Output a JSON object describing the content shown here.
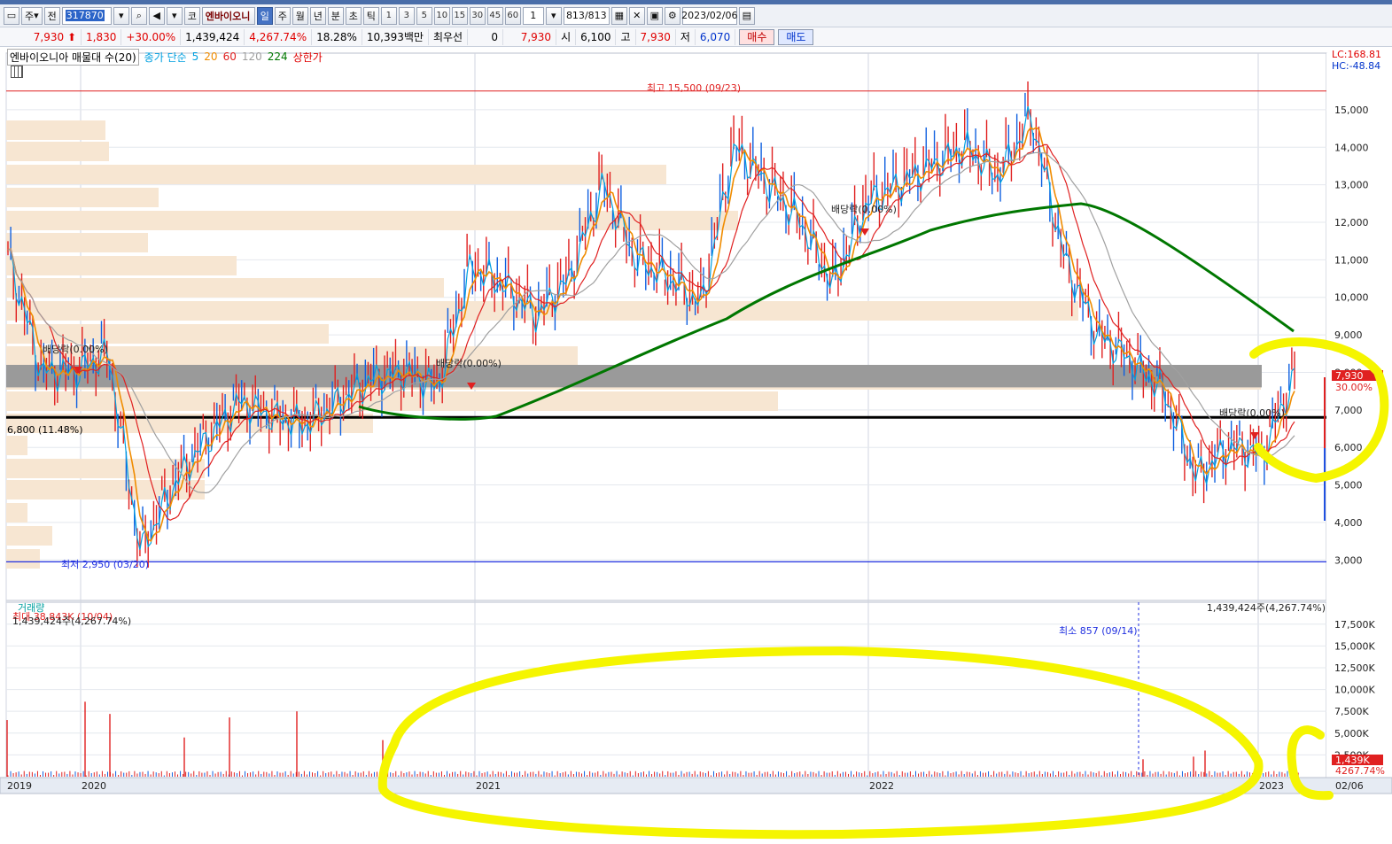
{
  "toolbar": {
    "period_labels": [
      "주",
      "전"
    ],
    "code": "317870",
    "kind": "코",
    "stock_name": "엔바이오니",
    "intervals": [
      "일",
      "주",
      "월",
      "년",
      "분",
      "초",
      "틱"
    ],
    "active_interval": "일",
    "minute_options": [
      "1",
      "3",
      "5",
      "10",
      "15",
      "30",
      "45",
      "60"
    ],
    "unit_value": "1",
    "counter_current": "813",
    "counter_total": "/813",
    "date": "2023/02/06"
  },
  "quote": {
    "price": "7,930",
    "change": "1,830",
    "change_pct": "+30.00%",
    "volume": "1,439,424",
    "volume_ratio": "4,267.74%",
    "turnover": "18.28%",
    "amount": "10,393백만",
    "pref_label": "최우선",
    "pref_value": "0",
    "pref_price": "7,930",
    "open_label": "시",
    "open": "6,100",
    "high_label": "고",
    "high": "7,930",
    "low_label": "저",
    "low": "6,070",
    "buy_label": "매수",
    "sell_label": "매도"
  },
  "legend": {
    "title": "엔바이오니아 매물대 수(20)",
    "ma_label": "종가 단순",
    "ma_periods": [
      "5",
      "20",
      "60",
      "120",
      "224"
    ],
    "ma_colors": [
      "#00a0e0",
      "#f08c00",
      "#e02020",
      "#a0a0a0",
      "#007700"
    ],
    "limit_label": "상한가",
    "lc": "LC:168.81",
    "hc": "HC:-48.84"
  },
  "annotations": {
    "high_label": "최고 15,500 (09/23)",
    "low_label": "최저 2,950 (03/20)",
    "dividend_labels": [
      "배당락(0.00%)",
      "배당락(0.00%)",
      "배당락(0.00%)",
      "배당락(0.00%)"
    ],
    "hline_label": "6,800 (11.48%)",
    "price_tag": "7,930",
    "pct_tag": "30.00%",
    "volume_panel_title": "거래량",
    "volume_current_left": "1,439,424주(4,267.74%)",
    "volume_max_left": "최대 38,843K (10/04)",
    "volume_current_right": "1,439,424주(4,267.74%)",
    "volume_min_label": "최소 857 (09/14)",
    "volume_tag": "1,439K",
    "volume_pct_tag": "4267.74%"
  },
  "chart_data": [
    {
      "type": "line",
      "title": "",
      "x": [
        "2019-09",
        "2019-11",
        "2020-01",
        "2020-02",
        "2020-03",
        "2020-04",
        "2020-05",
        "2020-06",
        "2020-07",
        "2020-08",
        "2020-09",
        "2020-10",
        "2020-11",
        "2020-12",
        "2021-01",
        "2021-02",
        "2021-03",
        "2021-04",
        "2021-05",
        "2021-06",
        "2021-07",
        "2021-08",
        "2021-09",
        "2021-10",
        "2021-11",
        "2021-12",
        "2022-01",
        "2022-02",
        "2022-03",
        "2022-04",
        "2022-05",
        "2022-06",
        "2022-07",
        "2022-08",
        "2022-09",
        "2022-10",
        "2022-11",
        "2022-12",
        "2023-01",
        "2023-02"
      ],
      "series": [
        {
          "name": "종가",
          "values": [
            11000,
            8000,
            8000,
            8500,
            3200,
            5000,
            6200,
            7200,
            6800,
            6600,
            7200,
            7800,
            8000,
            7600,
            10800,
            10300,
            9500,
            10500,
            13000,
            11000,
            10500,
            9800,
            14000,
            13000,
            12000,
            10300,
            12500,
            13000,
            13500,
            14000,
            13200,
            14800,
            11000,
            9000,
            8300,
            7500,
            5200,
            6000,
            5800,
            7930
          ]
        }
      ],
      "x_ticks": [
        "2019",
        "2020",
        "2021",
        "2022",
        "2023",
        "02/06"
      ],
      "y_ticks": [
        "3,000",
        "4,000",
        "5,000",
        "6,000",
        "7,000",
        "8,000",
        "9,000",
        "10,000",
        "11,000",
        "12,000",
        "13,000",
        "14,000",
        "15,000"
      ],
      "ylim": [
        2700,
        15800
      ],
      "reference_lines": [
        15500,
        2950,
        6800
      ],
      "grid": true
    },
    {
      "type": "bar",
      "title": "",
      "y_ticks": [
        "2,500K",
        "5,000K",
        "7,500K",
        "10,000K",
        "12,500K",
        "15,000K",
        "17,500K"
      ],
      "ylim": [
        0,
        19000
      ],
      "spikes_k": [
        8600,
        7200,
        7500,
        6800,
        4500,
        4200,
        6500,
        2300,
        3000,
        2000,
        2200,
        1439
      ]
    }
  ]
}
